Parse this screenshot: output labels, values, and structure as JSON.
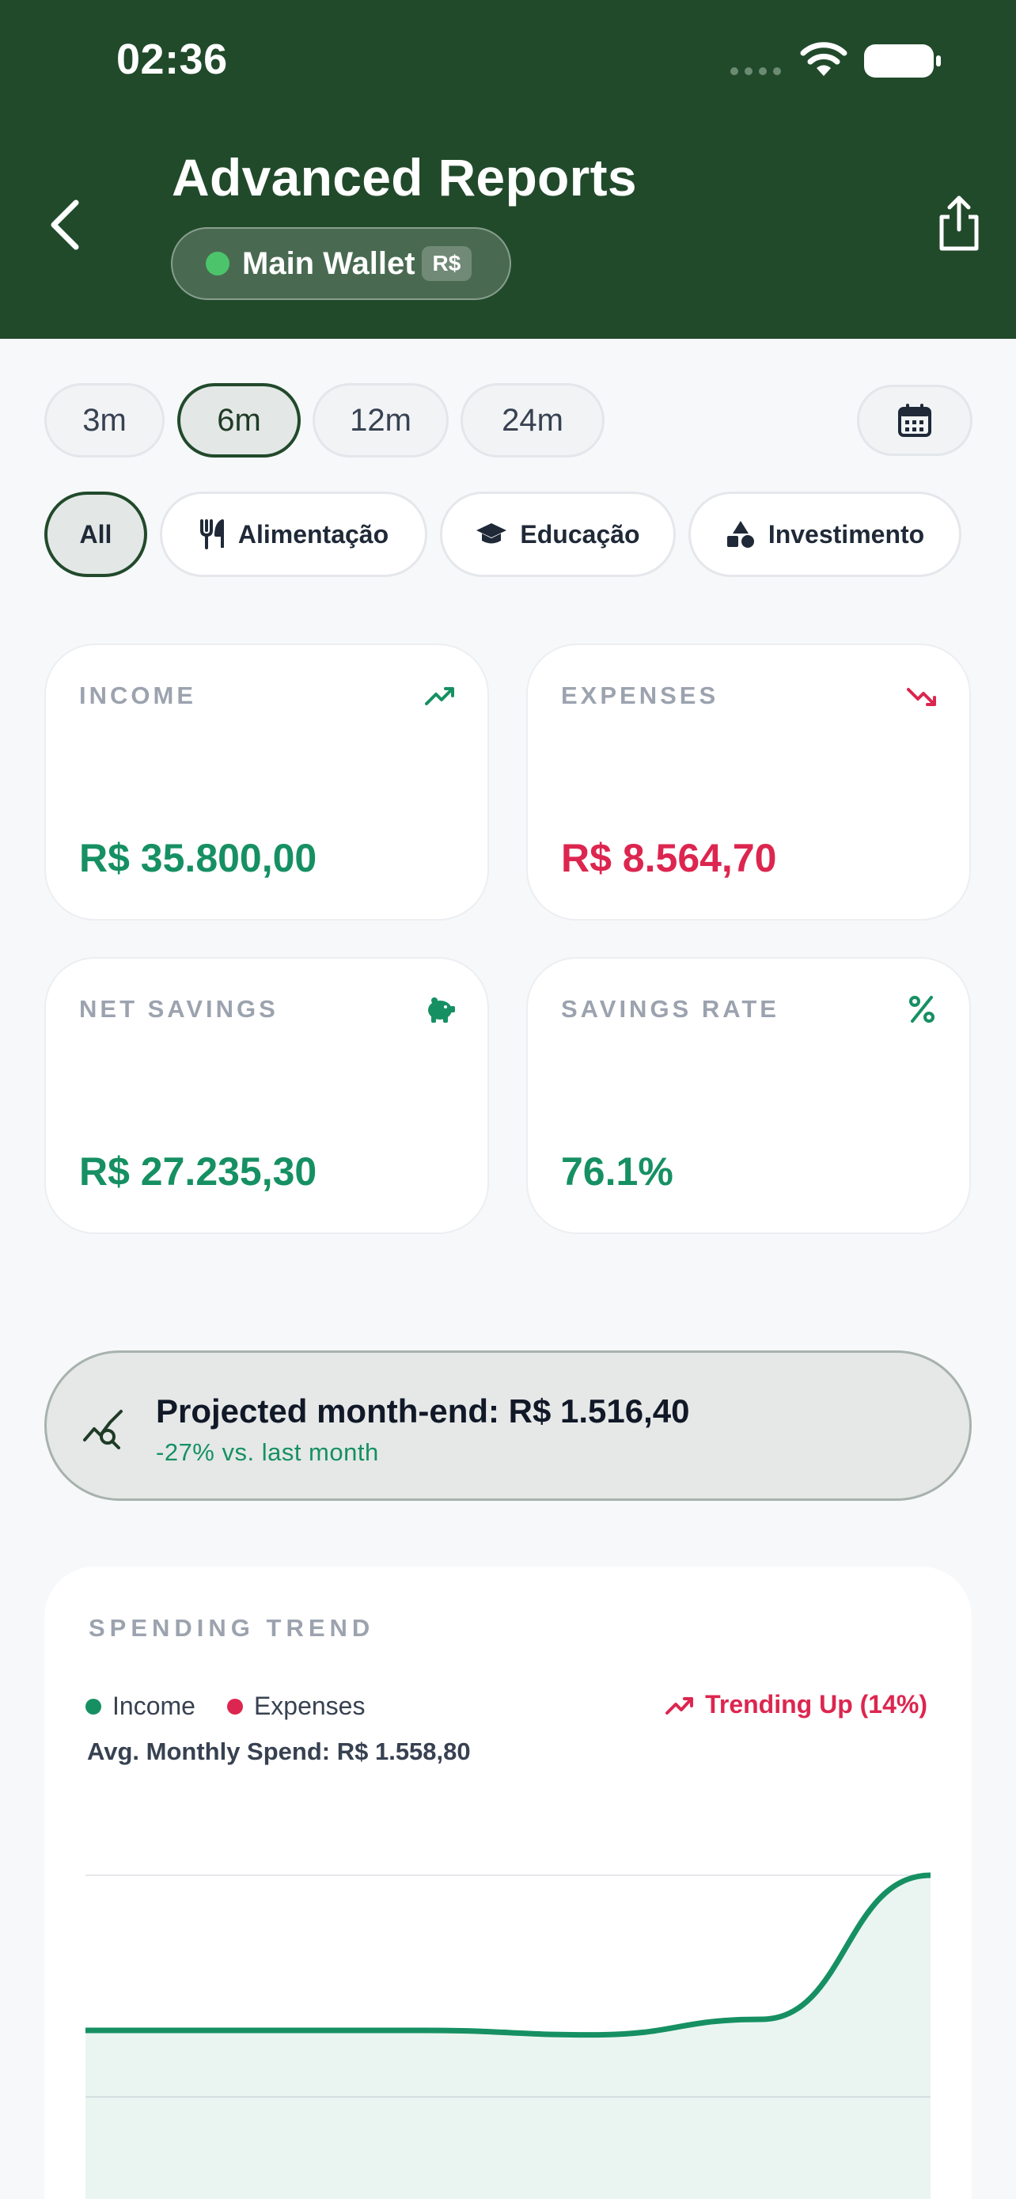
{
  "status_bar": {
    "time": "02:36"
  },
  "header": {
    "title": "Advanced Reports",
    "wallet_name": "Main Wallet",
    "wallet_currency": "R$"
  },
  "periods": [
    {
      "label": "3m",
      "active": false
    },
    {
      "label": "6m",
      "active": true
    },
    {
      "label": "12m",
      "active": false
    },
    {
      "label": "24m",
      "active": false
    }
  ],
  "categories": [
    {
      "label": "All",
      "icon": "",
      "active": true
    },
    {
      "label": "Alimentação",
      "icon": "utensils-icon",
      "active": false
    },
    {
      "label": "Educação",
      "icon": "graduation-cap-icon",
      "active": false
    },
    {
      "label": "Investimento",
      "icon": "shapes-icon",
      "active": false
    }
  ],
  "stats": {
    "income": {
      "label": "INCOME",
      "value": "R$ 35.800,00",
      "icon": "trending-up-icon"
    },
    "expenses": {
      "label": "EXPENSES",
      "value": "R$ 8.564,70",
      "icon": "trending-down-icon"
    },
    "net_savings": {
      "label": "NET SAVINGS",
      "value": "R$ 27.235,30",
      "icon": "piggy-bank-icon"
    },
    "savings_rate": {
      "label": "SAVINGS RATE",
      "value": "76.1%",
      "icon": "percent-icon"
    }
  },
  "projection": {
    "title": "Projected month-end: R$ 1.516,40",
    "subtitle": "-27% vs. last month",
    "icon": "chart-search-icon"
  },
  "spending_trend": {
    "title": "SPENDING TREND",
    "legend_income": "Income",
    "legend_expenses": "Expenses",
    "trend_badge": "Trending Up (14%)",
    "avg_spend": "Avg. Monthly Spend: R$ 1.558,80"
  },
  "colors": {
    "header_bg": "#214a2b",
    "income_green": "#169063",
    "expense_red": "#dc264f",
    "wallet_dot": "#4cc46b"
  },
  "chart_data": {
    "type": "area",
    "series": [
      {
        "name": "Income",
        "values": [
          0.3,
          0.3,
          0.3,
          0.28,
          0.35,
          1.0
        ]
      },
      {
        "name": "Expenses",
        "values": []
      }
    ],
    "ylim": [
      0,
      1
    ],
    "grid": true,
    "xlabel": "",
    "ylabel": ""
  }
}
